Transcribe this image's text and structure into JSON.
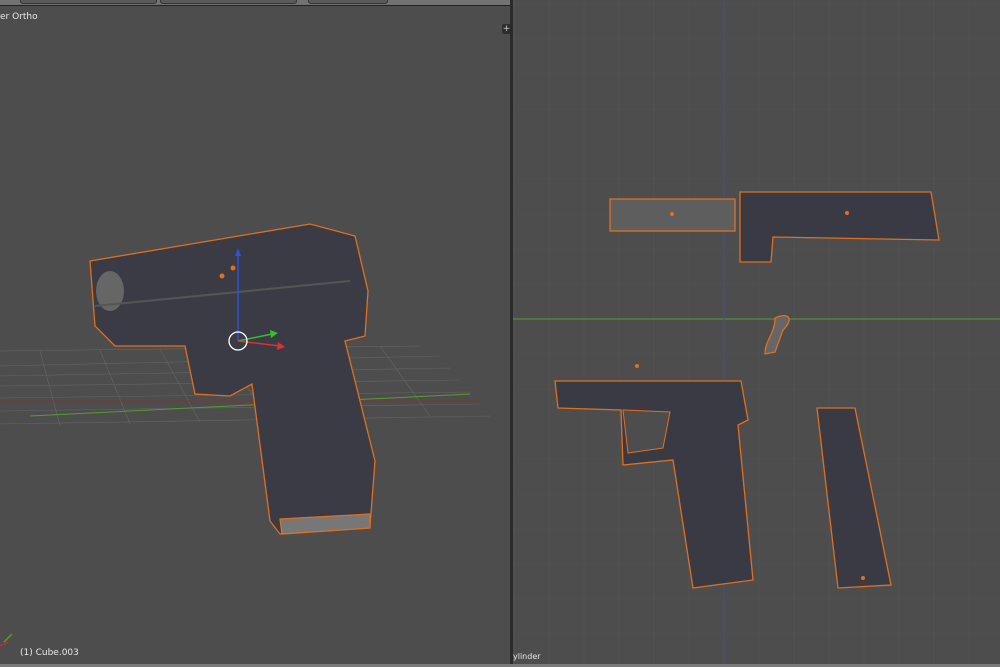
{
  "left_viewport": {
    "view_name": "er Ortho",
    "object_info": "(1) Cube.003",
    "plus_button": "+"
  },
  "right_viewport": {
    "object_info": "ylinder"
  },
  "colors": {
    "background": "#4d4d4d",
    "selection_outline": "#e07020",
    "x_axis": "#a03030",
    "y_axis": "#5a9a30",
    "mesh": "#3a3a44"
  }
}
